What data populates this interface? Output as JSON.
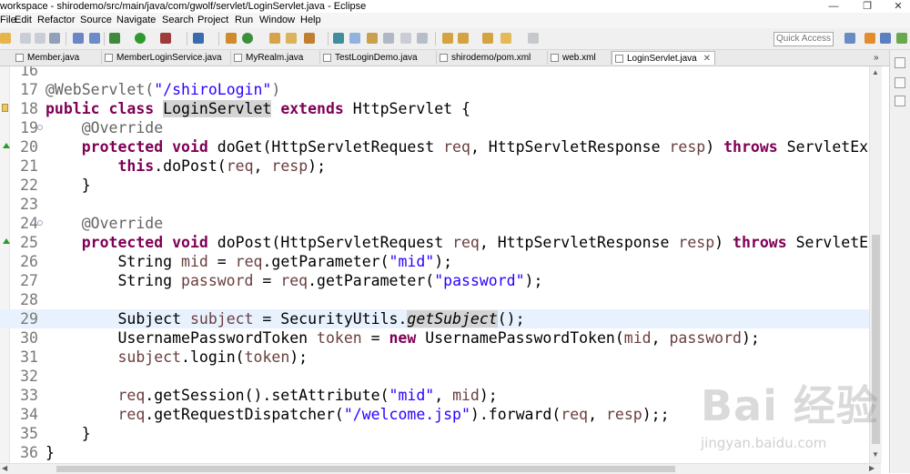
{
  "window": {
    "title": "workspace - shirodemo/src/main/java/com/gwolf/servlet/LoginServlet.java - Eclipse",
    "minimize_glyph": "—",
    "restore_glyph": "❐",
    "close_glyph": "✕"
  },
  "menu": [
    "File",
    "Edit",
    "Refactor",
    "Source",
    "Navigate",
    "Search",
    "Project",
    "Run",
    "Window",
    "Help"
  ],
  "toolbar": {
    "quick_access_placeholder": "Quick Access"
  },
  "tabs": [
    {
      "label": "Member.java",
      "active": false
    },
    {
      "label": "MemberLoginService.java",
      "active": false
    },
    {
      "label": "MyRealm.java",
      "active": false
    },
    {
      "label": "TestLoginDemo.java",
      "active": false
    },
    {
      "label": "shirodemo/pom.xml",
      "active": false
    },
    {
      "label": "web.xml",
      "active": false
    },
    {
      "label": "LoginServlet.java",
      "active": true,
      "close": "✕"
    }
  ],
  "tab_overflow": "»",
  "code": {
    "current_line": 29,
    "lines": [
      {
        "n": "16",
        "segs": []
      },
      {
        "n": "17",
        "segs": [
          {
            "c": "ann",
            "t": "@WebServlet("
          },
          {
            "c": "str",
            "t": "\"/shiroLogin\""
          },
          {
            "c": "ann",
            "t": ")"
          }
        ]
      },
      {
        "n": "18",
        "segs": [
          {
            "c": "kw",
            "t": "public"
          },
          {
            "c": "",
            "t": " "
          },
          {
            "c": "kw",
            "t": "class"
          },
          {
            "c": "",
            "t": " "
          },
          {
            "c": "occ",
            "t": "LoginServlet"
          },
          {
            "c": "",
            "t": " "
          },
          {
            "c": "kw",
            "t": "extends"
          },
          {
            "c": "",
            "t": " HttpServlet {"
          }
        ]
      },
      {
        "n": "19",
        "segs": [
          {
            "c": "",
            "t": "    "
          },
          {
            "c": "ann",
            "t": "@Override"
          }
        ]
      },
      {
        "n": "20",
        "segs": [
          {
            "c": "",
            "t": "    "
          },
          {
            "c": "kw",
            "t": "protected"
          },
          {
            "c": "",
            "t": " "
          },
          {
            "c": "kw",
            "t": "void"
          },
          {
            "c": "",
            "t": " doGet(HttpServletRequest "
          },
          {
            "c": "var",
            "t": "req"
          },
          {
            "c": "",
            "t": ", HttpServletResponse "
          },
          {
            "c": "var",
            "t": "resp"
          },
          {
            "c": "",
            "t": ") "
          },
          {
            "c": "kw",
            "t": "throws"
          },
          {
            "c": "",
            "t": " ServletExce"
          }
        ]
      },
      {
        "n": "21",
        "segs": [
          {
            "c": "",
            "t": "        "
          },
          {
            "c": "kw",
            "t": "this"
          },
          {
            "c": "",
            "t": ".doPost("
          },
          {
            "c": "var",
            "t": "req"
          },
          {
            "c": "",
            "t": ", "
          },
          {
            "c": "var",
            "t": "resp"
          },
          {
            "c": "",
            "t": ");"
          }
        ]
      },
      {
        "n": "22",
        "segs": [
          {
            "c": "",
            "t": "    }"
          }
        ]
      },
      {
        "n": "23",
        "segs": []
      },
      {
        "n": "24",
        "segs": [
          {
            "c": "",
            "t": "    "
          },
          {
            "c": "ann",
            "t": "@Override"
          }
        ]
      },
      {
        "n": "25",
        "segs": [
          {
            "c": "",
            "t": "    "
          },
          {
            "c": "kw",
            "t": "protected"
          },
          {
            "c": "",
            "t": " "
          },
          {
            "c": "kw",
            "t": "void"
          },
          {
            "c": "",
            "t": " doPost(HttpServletRequest "
          },
          {
            "c": "var",
            "t": "req"
          },
          {
            "c": "",
            "t": ", HttpServletResponse "
          },
          {
            "c": "var",
            "t": "resp"
          },
          {
            "c": "",
            "t": ") "
          },
          {
            "c": "kw",
            "t": "throws"
          },
          {
            "c": "",
            "t": " ServletExc"
          }
        ]
      },
      {
        "n": "26",
        "segs": [
          {
            "c": "",
            "t": "        String "
          },
          {
            "c": "var",
            "t": "mid"
          },
          {
            "c": "",
            "t": " = "
          },
          {
            "c": "var",
            "t": "req"
          },
          {
            "c": "",
            "t": ".getParameter("
          },
          {
            "c": "str",
            "t": "\"mid\""
          },
          {
            "c": "",
            "t": ");"
          }
        ]
      },
      {
        "n": "27",
        "segs": [
          {
            "c": "",
            "t": "        String "
          },
          {
            "c": "var",
            "t": "password"
          },
          {
            "c": "",
            "t": " = "
          },
          {
            "c": "var",
            "t": "req"
          },
          {
            "c": "",
            "t": ".getParameter("
          },
          {
            "c": "str",
            "t": "\"password\""
          },
          {
            "c": "",
            "t": ");"
          }
        ]
      },
      {
        "n": "28",
        "segs": []
      },
      {
        "n": "29",
        "segs": [
          {
            "c": "",
            "t": "        Subject "
          },
          {
            "c": "var",
            "t": "subject"
          },
          {
            "c": "",
            "t": " = SecurityUtils."
          },
          {
            "c": "ital occ",
            "t": "getSubject"
          },
          {
            "c": "",
            "t": "();"
          }
        ]
      },
      {
        "n": "30",
        "segs": [
          {
            "c": "",
            "t": "        UsernamePasswordToken "
          },
          {
            "c": "var",
            "t": "token"
          },
          {
            "c": "",
            "t": " = "
          },
          {
            "c": "kw",
            "t": "new"
          },
          {
            "c": "",
            "t": " UsernamePasswordToken("
          },
          {
            "c": "var",
            "t": "mid"
          },
          {
            "c": "",
            "t": ", "
          },
          {
            "c": "var",
            "t": "password"
          },
          {
            "c": "",
            "t": ");"
          }
        ]
      },
      {
        "n": "31",
        "segs": [
          {
            "c": "",
            "t": "        "
          },
          {
            "c": "var",
            "t": "subject"
          },
          {
            "c": "",
            "t": ".login("
          },
          {
            "c": "var",
            "t": "token"
          },
          {
            "c": "",
            "t": ");"
          }
        ]
      },
      {
        "n": "32",
        "segs": []
      },
      {
        "n": "33",
        "segs": [
          {
            "c": "",
            "t": "        "
          },
          {
            "c": "var",
            "t": "req"
          },
          {
            "c": "",
            "t": ".getSession().setAttribute("
          },
          {
            "c": "str",
            "t": "\"mid\""
          },
          {
            "c": "",
            "t": ", "
          },
          {
            "c": "var",
            "t": "mid"
          },
          {
            "c": "",
            "t": ");"
          }
        ]
      },
      {
        "n": "34",
        "segs": [
          {
            "c": "",
            "t": "        "
          },
          {
            "c": "var",
            "t": "req"
          },
          {
            "c": "",
            "t": ".getRequestDispatcher("
          },
          {
            "c": "str",
            "t": "\"/welcome.jsp\""
          },
          {
            "c": "",
            "t": ").forward("
          },
          {
            "c": "var",
            "t": "req"
          },
          {
            "c": "",
            "t": ", "
          },
          {
            "c": "var",
            "t": "resp"
          },
          {
            "c": "",
            "t": ");;"
          }
        ]
      },
      {
        "n": "35",
        "segs": [
          {
            "c": "",
            "t": "    }"
          }
        ]
      },
      {
        "n": "36",
        "segs": [
          {
            "c": "",
            "t": "}"
          }
        ]
      }
    ]
  },
  "watermark": {
    "logo": "Bai 经验",
    "url": "jingyan.baidu.com"
  },
  "colors": {
    "keyword": "#7f0055",
    "string": "#2a00ff",
    "annotation": "#646464",
    "variable": "#6a3e3e",
    "current_line": "#e8f2fe"
  }
}
